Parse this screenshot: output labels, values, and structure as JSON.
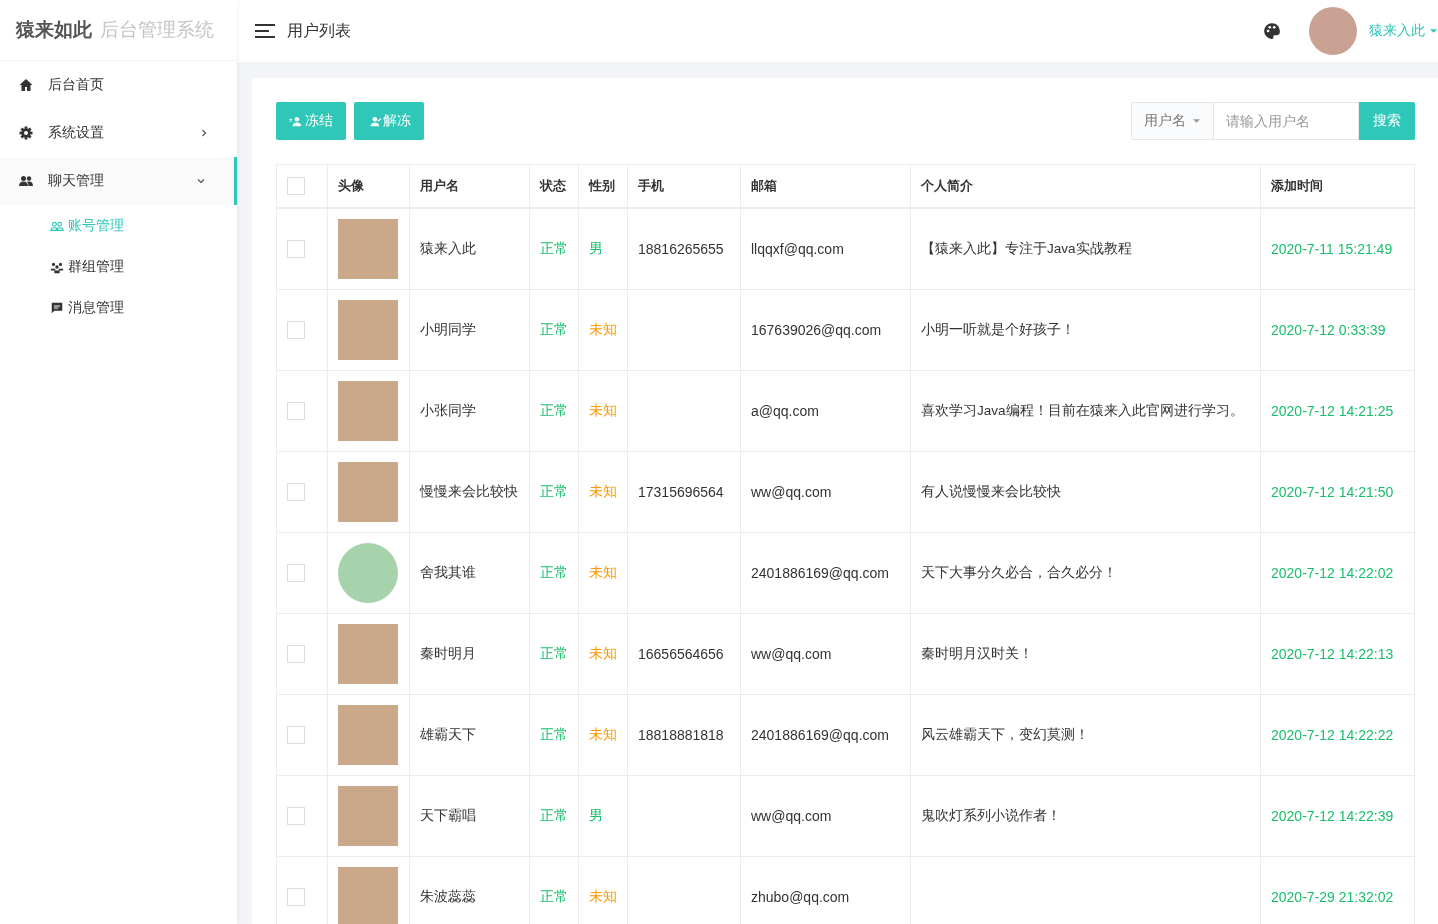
{
  "logo": {
    "brand": "猿来如此",
    "subtitle": "后台管理系统"
  },
  "sidebar": {
    "items": [
      {
        "kind": "home",
        "label": "后台首页",
        "selected": false
      },
      {
        "kind": "gear",
        "label": "系统设置",
        "selected": false,
        "expanded": false
      },
      {
        "kind": "people",
        "label": "聊天管理",
        "selected": true,
        "expanded": true,
        "children": [
          {
            "kind": "account",
            "label": "账号管理",
            "selected": true
          },
          {
            "kind": "group",
            "label": "群组管理",
            "selected": false
          },
          {
            "kind": "message",
            "label": "消息管理",
            "selected": false
          }
        ]
      }
    ]
  },
  "header": {
    "title": "用户列表",
    "user": "猿来入此"
  },
  "toolbar": {
    "buttons": [
      {
        "kind": "freeze",
        "label": "冻结"
      },
      {
        "kind": "unfreeze",
        "label": "解冻"
      }
    ],
    "search_field": "用户名",
    "placeholder": "请输入用户名",
    "search_button": "搜索"
  },
  "table": {
    "select_all_checked": false,
    "columns": [
      "头像",
      "用户名",
      "状态",
      "性别",
      "手机",
      "邮箱",
      "个人简介",
      "添加时间"
    ],
    "rows": [
      {
        "checked": false,
        "kind": "photo",
        "username": "猿来入此",
        "status": "正常",
        "gender": {
          "text": "男",
          "color": "#19be6b"
        },
        "phone": "18816265655",
        "email": "llqqxf@qq.com",
        "bio": "【猿来入此】专注于Java实战教程",
        "time": "2020-7-11 15:21:49"
      },
      {
        "checked": false,
        "kind": "photo",
        "username": "小明同学",
        "status": "正常",
        "gender": {
          "text": "未知",
          "color": "#ff9900"
        },
        "email": "167639026@qq.com",
        "bio": "小明一听就是个好孩子！",
        "time": "2020-7-12 0:33:39"
      },
      {
        "checked": false,
        "kind": "photo",
        "username": "小张同学",
        "status": "正常",
        "gender": {
          "text": "未知",
          "color": "#ff9900"
        },
        "email": "a@qq.com",
        "bio": "喜欢学习Java编程！目前在猿来入此官网进行学习。",
        "time": "2020-7-12 14:21:25"
      },
      {
        "checked": false,
        "kind": "photo",
        "username": "慢慢来会比较快",
        "status": "正常",
        "gender": {
          "text": "未知",
          "color": "#ff9900"
        },
        "phone": "17315696564",
        "email": "ww@qq.com",
        "bio": "有人说慢慢来会比较快",
        "time": "2020-7-12 14:21:50"
      },
      {
        "checked": false,
        "kind": "cartoon",
        "username": "舍我其谁",
        "status": "正常",
        "gender": {
          "text": "未知",
          "color": "#ff9900"
        },
        "email": "2401886169@qq.com",
        "bio": "天下大事分久必合，合久必分！",
        "time": "2020-7-12 14:22:02"
      },
      {
        "checked": false,
        "kind": "photo",
        "username": "秦时明月",
        "status": "正常",
        "gender": {
          "text": "未知",
          "color": "#ff9900"
        },
        "phone": "16656564656",
        "email": "ww@qq.com",
        "bio": "秦时明月汉时关！",
        "time": "2020-7-12 14:22:13"
      },
      {
        "checked": false,
        "kind": "photo",
        "username": "雄霸天下",
        "status": "正常",
        "gender": {
          "text": "未知",
          "color": "#ff9900"
        },
        "phone": "18818881818",
        "email": "2401886169@qq.com",
        "bio": "风云雄霸天下，变幻莫测！",
        "time": "2020-7-12 14:22:22"
      },
      {
        "checked": false,
        "kind": "photo",
        "username": "天下霸唱",
        "status": "正常",
        "gender": {
          "text": "男",
          "color": "#19be6b"
        },
        "email": "ww@qq.com",
        "bio": "鬼吹灯系列小说作者！",
        "time": "2020-7-12 14:22:39"
      },
      {
        "checked": false,
        "kind": "photo",
        "username": "朱波蕊蕊",
        "status": "正常",
        "gender": {
          "text": "未知",
          "color": "#ff9900"
        },
        "email": "zhubo@qq.com",
        "time": "2020-7-29 21:32:02"
      }
    ]
  }
}
